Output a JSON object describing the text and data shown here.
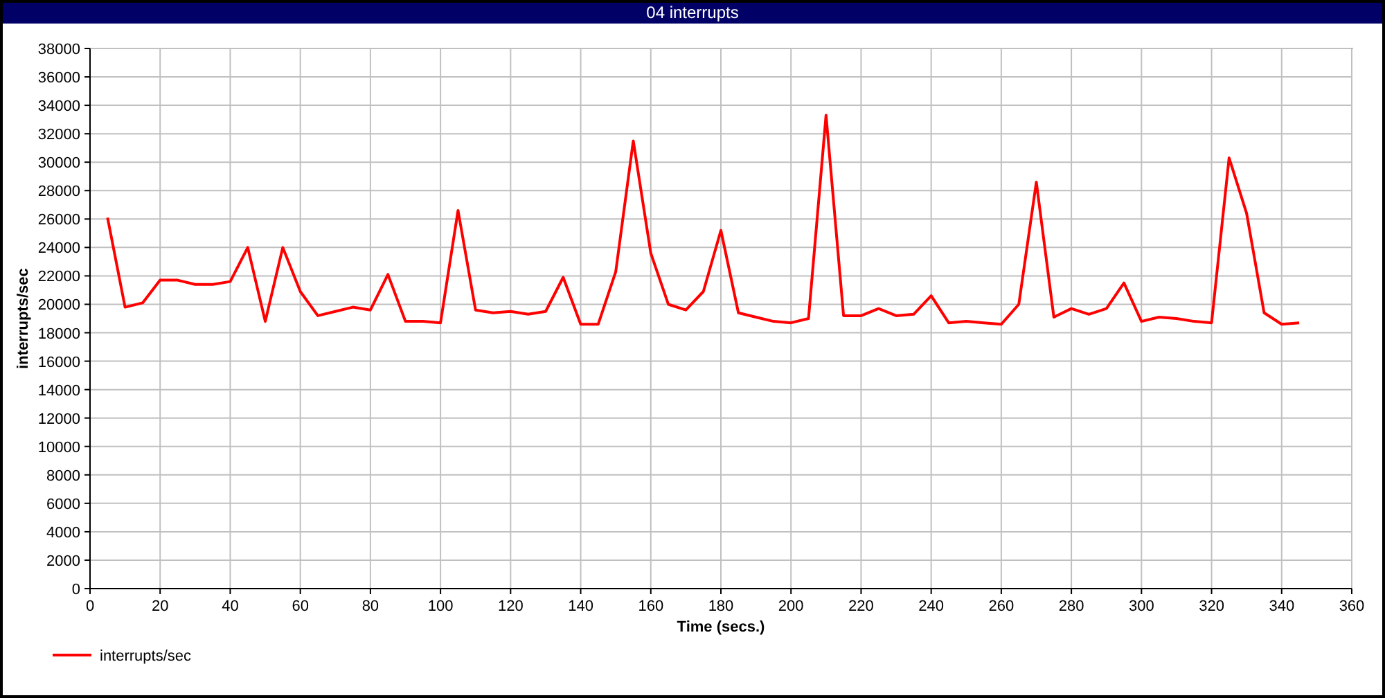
{
  "window": {
    "title": "04 interrupts"
  },
  "chart": {
    "chart_data": {
      "type": "line",
      "grid": true,
      "xlabel": "Time (secs.)",
      "ylabel": "interrupts/sec",
      "xlim": [
        0,
        360
      ],
      "ylim": [
        0,
        38000
      ],
      "xticks": [
        0,
        20,
        40,
        60,
        80,
        100,
        120,
        140,
        160,
        180,
        200,
        220,
        240,
        260,
        280,
        300,
        320,
        340,
        360
      ],
      "yticks": [
        0,
        2000,
        4000,
        6000,
        8000,
        10000,
        12000,
        14000,
        16000,
        18000,
        20000,
        22000,
        24000,
        26000,
        28000,
        30000,
        32000,
        34000,
        36000,
        38000
      ],
      "x": [
        5,
        10,
        15,
        20,
        25,
        30,
        35,
        40,
        45,
        50,
        55,
        60,
        65,
        70,
        75,
        80,
        85,
        90,
        95,
        100,
        105,
        110,
        115,
        120,
        125,
        130,
        135,
        140,
        145,
        150,
        155,
        160,
        165,
        170,
        175,
        180,
        185,
        190,
        195,
        200,
        205,
        210,
        215,
        220,
        225,
        230,
        235,
        240,
        245,
        250,
        255,
        260,
        265,
        270,
        275,
        280,
        285,
        290,
        295,
        300,
        305,
        310,
        315,
        320,
        325,
        330,
        335,
        340,
        345
      ],
      "series": [
        {
          "name": "interrupts/sec",
          "color": "#ff0000",
          "values": [
            26100,
            19800,
            20100,
            21700,
            21700,
            21400,
            21400,
            21600,
            24000,
            18800,
            24000,
            20900,
            19200,
            19500,
            19800,
            19600,
            22100,
            18800,
            18800,
            18700,
            26600,
            19600,
            19400,
            19500,
            19300,
            19500,
            21900,
            18600,
            18600,
            22300,
            31500,
            23600,
            20000,
            19600,
            20900,
            25200,
            19400,
            19100,
            18800,
            18700,
            19000,
            33300,
            19200,
            19200,
            19700,
            19200,
            19300,
            20600,
            18700,
            18800,
            18700,
            18600,
            20000,
            28600,
            19100,
            19700,
            19300,
            19700,
            21500,
            18800,
            19100,
            19000,
            18800,
            18700,
            30300,
            26400,
            19400,
            18600,
            18700
          ]
        }
      ]
    }
  }
}
